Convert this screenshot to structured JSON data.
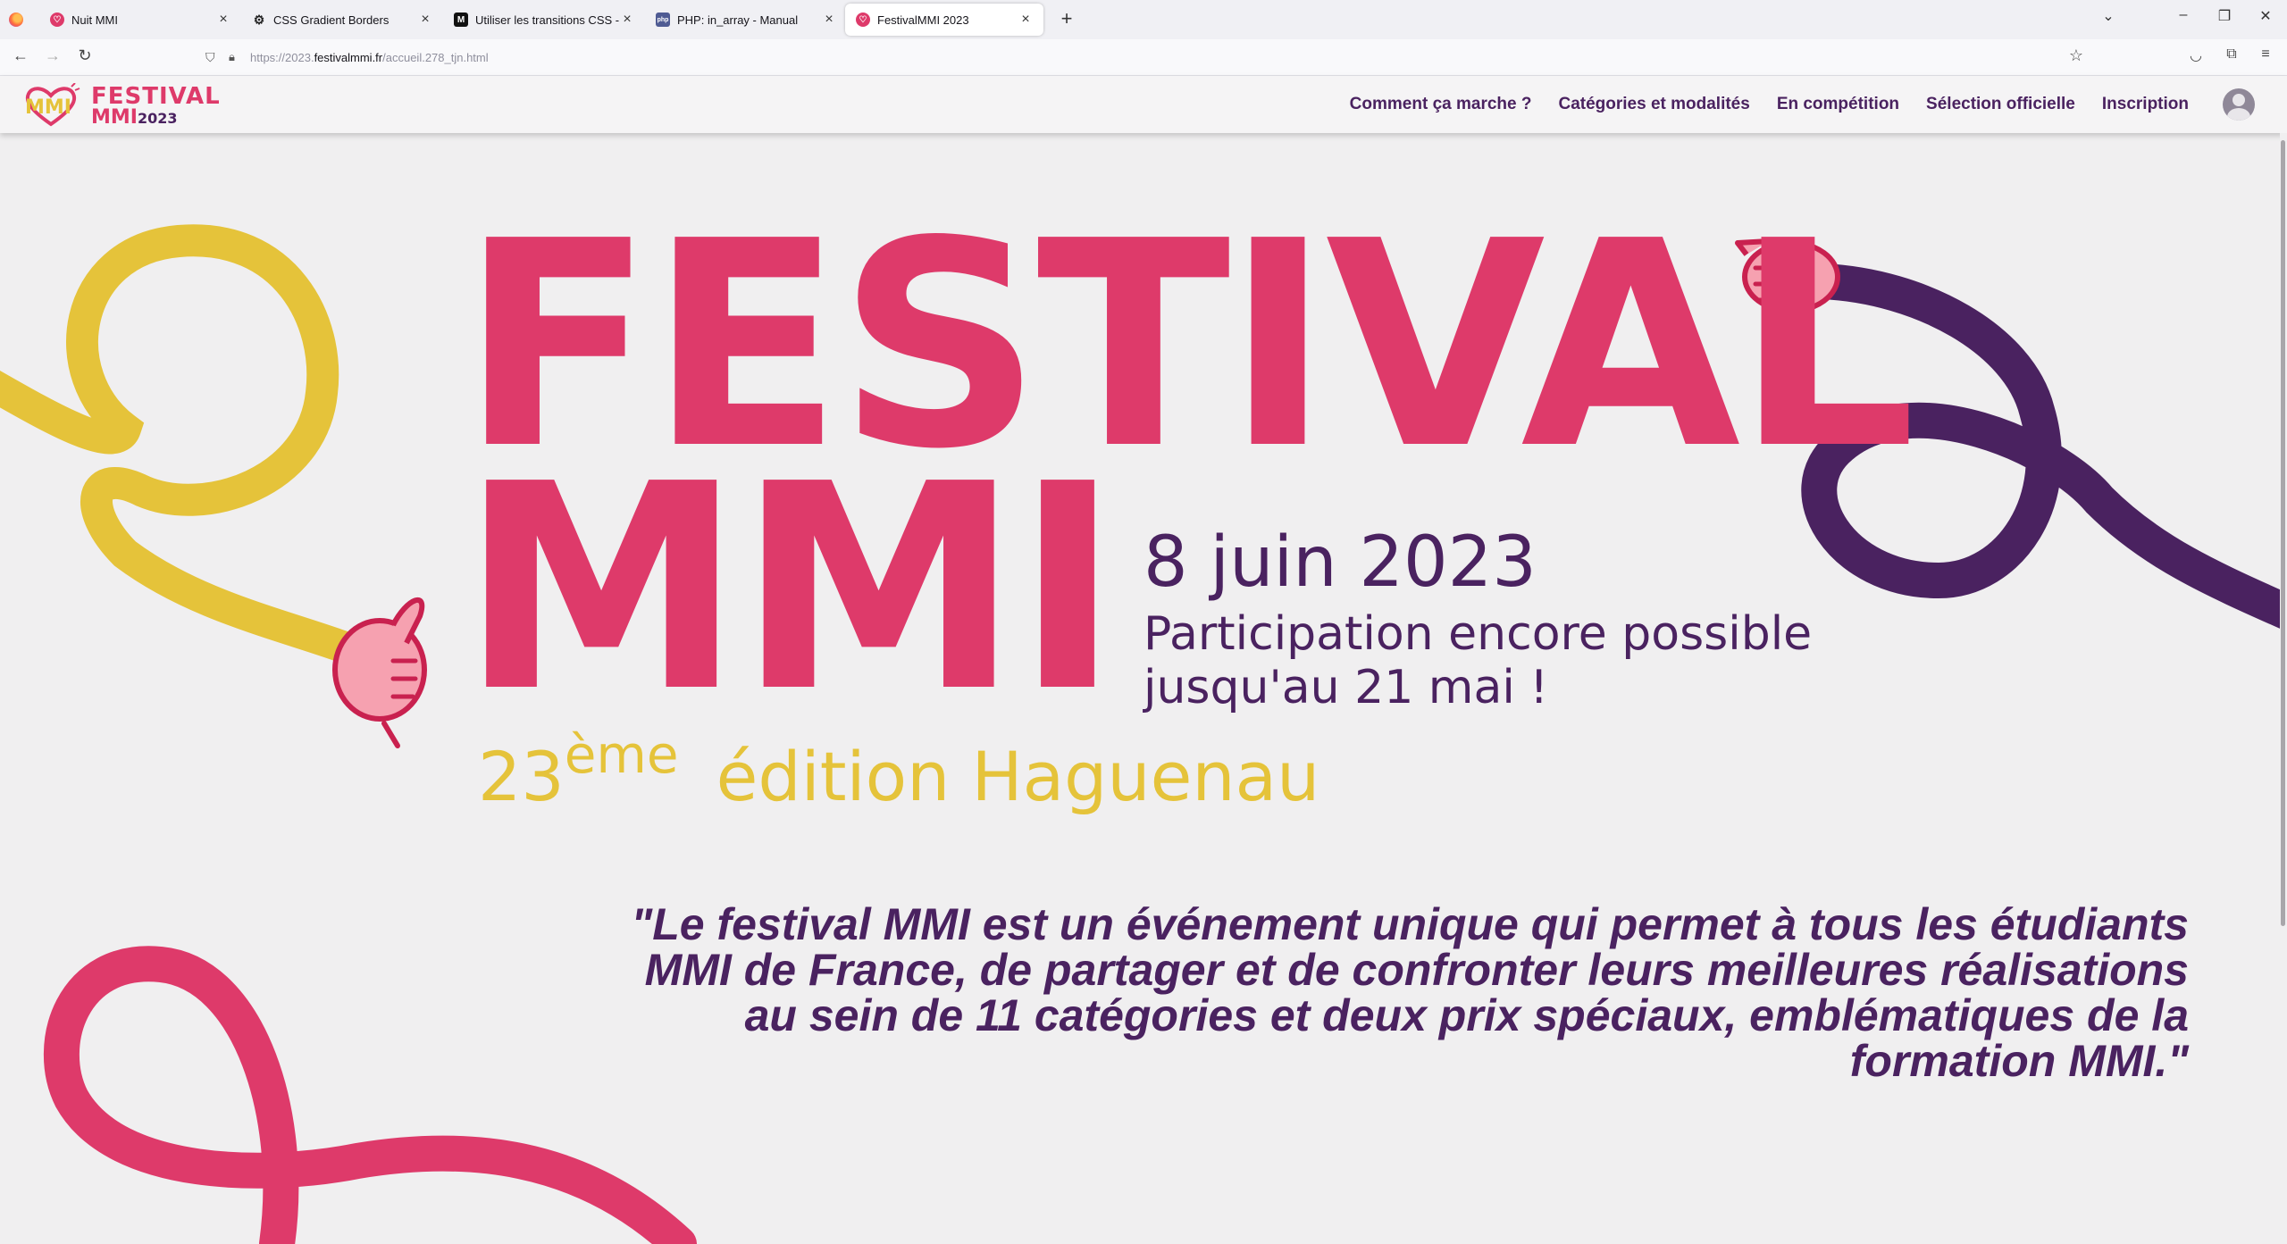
{
  "browser": {
    "tabs": [
      {
        "title": "Nuit MMI",
        "favicon": "festival-icon",
        "active": false
      },
      {
        "title": "CSS Gradient Borders",
        "favicon": "gear-icon",
        "active": false
      },
      {
        "title": "Utiliser les transitions CSS - CSS",
        "favicon": "mdn-icon",
        "active": false
      },
      {
        "title": "PHP: in_array - Manual",
        "favicon": "php-icon",
        "active": false
      },
      {
        "title": "FestivalMMI 2023",
        "favicon": "festival-icon",
        "active": true
      }
    ],
    "url_prefix": "https://2023.",
    "url_domain": "festivalmmi.fr",
    "url_path": "/accueil.278_tjn.html"
  },
  "site": {
    "logo_line1": "FESTIVAL",
    "logo_line2": "MMI",
    "logo_year": "2023",
    "menu": [
      "Comment ça marche ?",
      "Catégories et modalités",
      "En compétition",
      "Sélection officielle",
      "Inscription"
    ]
  },
  "hero": {
    "title_line1": "FESTIVAL",
    "title_line2": "MMI",
    "date": "8 juin 2023",
    "participation_line1": "Participation encore possible",
    "participation_line2": "jusqu'au 21 mai !",
    "edition_number": "23",
    "edition_suffix": "ème",
    "edition_place": "édition Haguenau",
    "quote": "\"Le festival MMI est un événement unique qui permet à tous les étudiants MMI de France, de partager et de confronter leurs meilleures réalisations au sein de 11 catégories et deux prix spéciaux, emblématiques de la formation MMI.\""
  },
  "colors": {
    "pink": "#de3a6a",
    "purple": "#4a2260",
    "yellow": "#e5c33a",
    "background": "#f0eff0"
  }
}
